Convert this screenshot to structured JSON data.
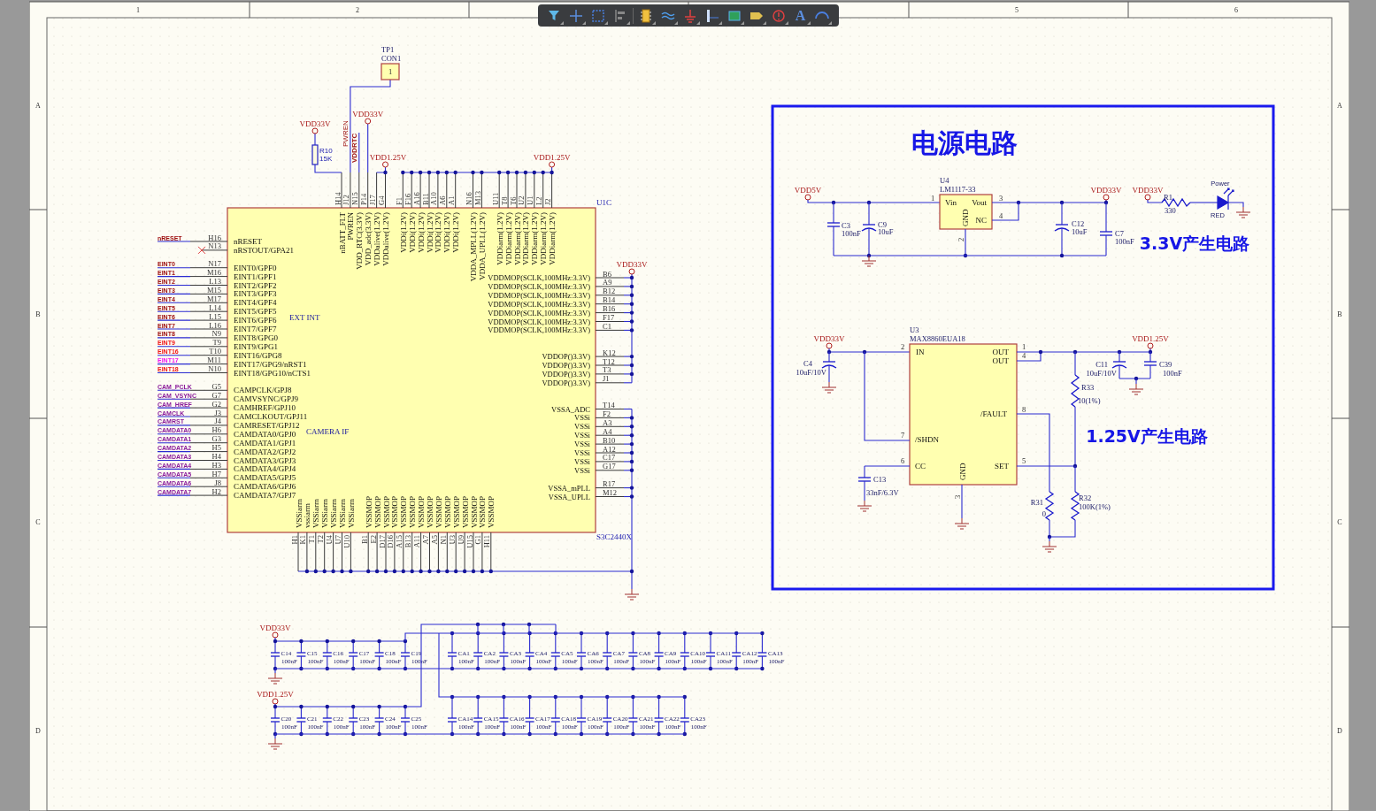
{
  "toolbar": {
    "text_tool_label": "A"
  },
  "frame": {
    "column_labels": [
      "1",
      "2",
      "5",
      "6"
    ],
    "row_labels_left": [
      "A",
      "B",
      "C",
      "D"
    ],
    "row_labels_right": [
      "A",
      "B",
      "C",
      "D"
    ]
  },
  "u1c": {
    "designator": "U1C",
    "part": "S3C2440X",
    "left_groups": [
      {
        "pins": [
          {
            "net": "nRESET",
            "color": "#9b0a0a",
            "pin": "H16",
            "name": "nRESET",
            "no_connect": false
          },
          {
            "pin": "N13",
            "name": "nRSTOUT/GPA21",
            "no_connect": true
          }
        ]
      },
      {
        "label": "EXT INT",
        "pins": [
          {
            "net": "EINT0",
            "color": "#9b0a0a",
            "pin": "N17",
            "name": "EINT0/GPF0",
            "no_connect": false
          },
          {
            "net": "EINT1",
            "color": "#9b0a0a",
            "pin": "M16",
            "name": "EINT1/GPF1",
            "no_connect": false
          },
          {
            "net": "EINT2",
            "color": "#9b0a0a",
            "pin": "L13",
            "name": "EINT2/GPF2",
            "no_connect": false
          },
          {
            "net": "EINT3",
            "color": "#9b0a0a",
            "pin": "M15",
            "name": "EINT3/GPF3",
            "no_connect": false
          },
          {
            "net": "EINT4",
            "color": "#9b0a0a",
            "pin": "M17",
            "name": "EINT4/GPF4",
            "no_connect": false
          },
          {
            "net": "EINT5",
            "color": "#9b0a0a",
            "pin": "L14",
            "name": "EINT5/GPF5",
            "no_connect": false
          },
          {
            "net": "EINT6",
            "color": "#9b0a0a",
            "pin": "L15",
            "name": "EINT6/GPF6",
            "no_connect": false
          },
          {
            "net": "EINT7",
            "color": "#9b0a0a",
            "pin": "L16",
            "name": "EINT7/GPF7",
            "no_connect": false
          },
          {
            "net": "EINT8",
            "color": "#9b0a0a",
            "pin": "N9",
            "name": "EINT8/GPG0",
            "no_connect": false
          },
          {
            "net": "EINT9",
            "color": "#f01414",
            "pin": "T9",
            "name": "EINT9/GPG1",
            "no_connect": false
          },
          {
            "net": "EINT16",
            "color": "#f01414",
            "pin": "T10",
            "name": "EINT16/GPG8",
            "no_connect": false
          },
          {
            "net": "EINT17",
            "color": "#f014f0",
            "pin": "M11",
            "name": "EINT17/GPG9/nRST1",
            "no_connect": false
          },
          {
            "net": "EINT18",
            "color": "#f01414",
            "pin": "N10",
            "name": "EINT18/GPG10/nCTS1",
            "no_connect": false
          }
        ]
      },
      {
        "label": "CAMERA IF",
        "pins": [
          {
            "net": "CAM_PCLK",
            "color": "#8a1a9a",
            "pin": "G5",
            "name": "CAMPCLK/GPJ8",
            "no_connect": false
          },
          {
            "net": "CAM_VSYNC",
            "color": "#8a1a9a",
            "pin": "G7",
            "name": "CAMVSYNC/GPJ9",
            "no_connect": false
          },
          {
            "net": "CAM_HREF",
            "color": "#8a1a9a",
            "pin": "G2",
            "name": "CAMHREF/GPJ10",
            "no_connect": false
          },
          {
            "net": "CAMCLK",
            "color": "#8a1a9a",
            "pin": "J3",
            "name": "CAMCLKOUT/GPJ11",
            "no_connect": false
          },
          {
            "net": "CAMRST",
            "color": "#8a1a9a",
            "pin": "J4",
            "name": "CAMRESET/GPJ12",
            "no_connect": false
          },
          {
            "net": "CAMDATA0",
            "color": "#8a1a9a",
            "pin": "H6",
            "name": "CAMDATA0/GPJ0",
            "no_connect": false
          },
          {
            "net": "CAMDATA1",
            "color": "#8a1a9a",
            "pin": "G3",
            "name": "CAMDATA1/GPJ1",
            "no_connect": false
          },
          {
            "net": "CAMDATA2",
            "color": "#8a1a9a",
            "pin": "H5",
            "name": "CAMDATA2/GPJ2",
            "no_connect": false
          },
          {
            "net": "CAMDATA3",
            "color": "#8a1a9a",
            "pin": "H4",
            "name": "CAMDATA3/GPJ3",
            "no_connect": false
          },
          {
            "net": "CAMDATA4",
            "color": "#8a1a9a",
            "pin": "H3",
            "name": "CAMDATA4/GPJ4",
            "no_connect": false
          },
          {
            "net": "CAMDATA5",
            "color": "#8a1a9a",
            "pin": "H7",
            "name": "CAMDATA5/GPJ5",
            "no_connect": false
          },
          {
            "net": "CAMDATA6",
            "color": "#8a1a9a",
            "pin": "J8",
            "name": "CAMDATA6/GPJ6",
            "no_connect": false
          },
          {
            "net": "CAMDATA7",
            "color": "#8a1a9a",
            "pin": "H2",
            "name": "CAMDATA7/GPJ7",
            "no_connect": false
          }
        ]
      }
    ],
    "top_groups": [
      {
        "pins": [
          {
            "pin": "H14",
            "name": "nBATT_FLT"
          },
          {
            "pin": "J12",
            "name": "PWREN"
          },
          {
            "pin": "N15",
            "name": "VDD_RTC(3.3V)"
          },
          {
            "pin": "P14",
            "name": "VDD_adc(3.3V)"
          },
          {
            "pin": "J17",
            "name": "VDDalive(1.2V)"
          },
          {
            "pin": "G4",
            "name": "VDDalive(1.2V)"
          }
        ]
      },
      {
        "pins": [
          {
            "pin": "F1",
            "name": "VDDi(1.2V)"
          },
          {
            "pin": "F16",
            "name": "VDDi(1.2V)"
          },
          {
            "pin": "A16",
            "name": "VDDi(1.2V)"
          },
          {
            "pin": "B11",
            "name": "VDDi(1.2V)"
          },
          {
            "pin": "A10",
            "name": "VDDi(1.2V)"
          },
          {
            "pin": "A6",
            "name": "VDDi(1.2V)"
          },
          {
            "pin": "A1",
            "name": "VDDi(1.2V)"
          }
        ]
      },
      {
        "pins": [
          {
            "pin": "N16",
            "name": "VDDA_MPLL(1.2V)"
          },
          {
            "pin": "M13",
            "name": "VDDA_UPLL(1.2V)"
          }
        ]
      },
      {
        "pins": [
          {
            "pin": "U11",
            "name": "VDDiarm(1.2V)"
          },
          {
            "pin": "T8",
            "name": "VDDiarm(1.2V)"
          },
          {
            "pin": "T6",
            "name": "VDDiarm(1.2V)"
          },
          {
            "pin": "U2",
            "name": "VDDiarm(1.2V)"
          },
          {
            "pin": "U1",
            "name": "VDDiarm(1.2V)"
          },
          {
            "pin": "L2",
            "name": "VDDiarm(1.2V)"
          },
          {
            "pin": "J2",
            "name": "VDDiarm(1.2V)"
          }
        ]
      }
    ],
    "right_groups": [
      {
        "pins": [
          {
            "pin": "B6",
            "name": "VDDMOP(SCLK,100MHz:3.3V)"
          },
          {
            "pin": "A9",
            "name": "VDDMOP(SCLK,100MHz:3.3V)"
          },
          {
            "pin": "B12",
            "name": "VDDMOP(SCLK,100MHz:3.3V)"
          },
          {
            "pin": "B14",
            "name": "VDDMOP(SCLK,100MHz:3.3V)"
          },
          {
            "pin": "B16",
            "name": "VDDMOP(SCLK,100MHz:3.3V)"
          },
          {
            "pin": "F17",
            "name": "VDDMOP(SCLK,100MHz:3.3V)"
          },
          {
            "pin": "C1",
            "name": "VDDMOP(SCLK,100MHz:3.3V)"
          }
        ]
      },
      {
        "pins": [
          {
            "pin": "K12",
            "name": "VDDOP()3.3V)"
          },
          {
            "pin": "T12",
            "name": "VDDOP()3.3V)"
          },
          {
            "pin": "T3",
            "name": "VDDOP()3.3V)"
          },
          {
            "pin": "J1",
            "name": "VDDOP()3.3V)"
          }
        ]
      },
      {
        "pins": [
          {
            "pin": "T14",
            "name": "VSSA_ADC"
          },
          {
            "pin": "F2",
            "name": "VSSi"
          },
          {
            "pin": "A3",
            "name": "VSSi"
          },
          {
            "pin": "A4",
            "name": "VSSi"
          },
          {
            "pin": "B10",
            "name": "VSSi"
          },
          {
            "pin": "A12",
            "name": "VSSi"
          },
          {
            "pin": "C17",
            "name": "VSSi"
          },
          {
            "pin": "G17",
            "name": "VSSi"
          }
        ]
      },
      {
        "pins": [
          {
            "pin": "R17",
            "name": "VSSA_mPLL"
          },
          {
            "pin": "M12",
            "name": "VSSA_UPLL"
          }
        ]
      }
    ],
    "bottom_groups": [
      {
        "pins": [
          {
            "pin": "H1",
            "name": "VSSiarm"
          },
          {
            "pin": "K1",
            "name": "vssiarm"
          },
          {
            "pin": "T1",
            "name": "VSSiarm"
          },
          {
            "pin": "T2",
            "name": "VSSiarm"
          },
          {
            "pin": "U4",
            "name": "VSSiarm"
          },
          {
            "pin": "U7",
            "name": "VSSiarm"
          },
          {
            "pin": "U10",
            "name": "VSSiarm"
          }
        ]
      },
      {
        "pins": [
          {
            "pin": "B1",
            "name": "VSSMOP"
          },
          {
            "pin": "E2",
            "name": "VSSMOP"
          },
          {
            "pin": "D17",
            "name": "VSSMOP"
          },
          {
            "pin": "D16",
            "name": "VSSMOP"
          },
          {
            "pin": "A15",
            "name": "VSSMOP"
          },
          {
            "pin": "B13",
            "name": "VSSMOP"
          },
          {
            "pin": "A11",
            "name": "VSSMOP"
          },
          {
            "pin": "A7",
            "name": "VSSMOP"
          },
          {
            "pin": "A5",
            "name": "VSSMOP"
          },
          {
            "pin": "N1",
            "name": "VSSMOP"
          },
          {
            "pin": "U3",
            "name": "VSSMOP"
          },
          {
            "pin": "U9",
            "name": "VSSMOP"
          },
          {
            "pin": "U15",
            "name": "VSSMOP"
          },
          {
            "pin": "G1",
            "name": "VSSMOP"
          },
          {
            "pin": "H11",
            "name": "VSSMOP"
          }
        ]
      }
    ],
    "ports": [
      "VDD33V",
      "VDD33V",
      "VDD1.25V",
      "VDD1.25V",
      "VDD33V"
    ],
    "net_labels": [
      "PWREN",
      "VDDRTC"
    ],
    "r10": {
      "designator": "R10",
      "value": "15K"
    },
    "tp1": {
      "designator": "TP1",
      "part": "CON1",
      "pin": "1"
    }
  },
  "power": {
    "title": "电源电路",
    "reg33": {
      "caption": "3.3V产生电路",
      "ports": [
        "VDD5V",
        "VDD33V",
        "VDD33V"
      ],
      "u": {
        "designator": "U4",
        "part": "LM1117-33",
        "pins": [
          {
            "name": "Vin",
            "number": "1"
          },
          {
            "name": "Vout",
            "number": "3"
          },
          {
            "name": "GND",
            "number": "2"
          },
          {
            "name": "NC",
            "number": "4"
          }
        ]
      },
      "caps": [
        {
          "designator": "C3",
          "value": "100nF",
          "kind": "ceramic"
        },
        {
          "designator": "C9",
          "value": "10uF",
          "kind": "polarized"
        },
        {
          "designator": "C12",
          "value": "10uF",
          "kind": "polarized"
        },
        {
          "designator": "C7",
          "value": "100nF",
          "kind": "ceramic"
        }
      ],
      "r1": {
        "designator": "R1",
        "value": "330"
      },
      "led": {
        "label": "Power",
        "color_label": "RED"
      }
    },
    "reg125": {
      "caption": "1.25V产生电路",
      "ports": [
        "VDD33V",
        "VDD1.25V"
      ],
      "u": {
        "designator": "U3",
        "part": "MAX8860EUA18",
        "pins": [
          {
            "name": "IN",
            "number": "2"
          },
          {
            "name": "OUT",
            "number": "1"
          },
          {
            "name": "OUT",
            "number": "4"
          },
          {
            "name": "/FAULT",
            "number": "8"
          },
          {
            "name": "/SHDN",
            "number": "7"
          },
          {
            "name": "CC",
            "number": "6"
          },
          {
            "name": "GND",
            "number": "3"
          },
          {
            "name": "SET",
            "number": "5"
          }
        ]
      },
      "caps": [
        {
          "designator": "C4",
          "value": "10uF/10V",
          "kind": "polarized"
        },
        {
          "designator": "C11",
          "value": "10uF/10V",
          "kind": "polarized"
        },
        {
          "designator": "C39",
          "value": "100nF",
          "kind": "ceramic"
        },
        {
          "designator": "C13",
          "value": "33nF/6.3V",
          "kind": "ceramic"
        }
      ],
      "resistors": [
        {
          "designator": "R33",
          "value": "10(1%)"
        },
        {
          "designator": "R31",
          "value": "0"
        },
        {
          "designator": "R32",
          "value": "100K(1%)"
        }
      ]
    }
  },
  "decoupling": {
    "rails": [
      {
        "port": "VDD33V",
        "local_caps": [
          {
            "designator": "C14",
            "value": "100nF"
          },
          {
            "designator": "C15",
            "value": "100nF"
          },
          {
            "designator": "C16",
            "value": "100nF"
          },
          {
            "designator": "C17",
            "value": "100nF"
          },
          {
            "designator": "C18",
            "value": "100nF"
          },
          {
            "designator": "C19",
            "value": "100nF"
          }
        ],
        "array_caps": [
          {
            "designator": "CA1",
            "value": "100nF"
          },
          {
            "designator": "CA2",
            "value": "100nF"
          },
          {
            "designator": "CA3",
            "value": "100nF"
          },
          {
            "designator": "CA4",
            "value": "100nF"
          },
          {
            "designator": "CA5",
            "value": "100nF"
          },
          {
            "designator": "CA6",
            "value": "100nF"
          },
          {
            "designator": "CA7",
            "value": "100nF"
          },
          {
            "designator": "CA8",
            "value": "100nF"
          },
          {
            "designator": "CA9",
            "value": "100nF"
          },
          {
            "designator": "CA10",
            "value": "100nF"
          },
          {
            "designator": "CA11",
            "value": "100nF"
          },
          {
            "designator": "CA12",
            "value": "100nF"
          },
          {
            "designator": "CA13",
            "value": "100nF"
          }
        ]
      },
      {
        "port": "VDD1.25V",
        "local_caps": [
          {
            "designator": "C20",
            "value": "100nF"
          },
          {
            "designator": "C21",
            "value": "100nF"
          },
          {
            "designator": "C22",
            "value": "100nF"
          },
          {
            "designator": "C23",
            "value": "100nF"
          },
          {
            "designator": "C24",
            "value": "100nF"
          },
          {
            "designator": "C25",
            "value": "100nF"
          }
        ],
        "array_caps": [
          {
            "designator": "CA14",
            "value": "100nF"
          },
          {
            "designator": "CA15",
            "value": "100nF"
          },
          {
            "designator": "CA16",
            "value": "100nF"
          },
          {
            "designator": "CA17",
            "value": "100nF"
          },
          {
            "designator": "CA18",
            "value": "100nF"
          },
          {
            "designator": "CA19",
            "value": "100nF"
          },
          {
            "designator": "CA20",
            "value": "100nF"
          },
          {
            "designator": "CA21",
            "value": "100nF"
          },
          {
            "designator": "CA22",
            "value": "100nF"
          },
          {
            "designator": "CA23",
            "value": "100nF"
          }
        ]
      }
    ]
  }
}
